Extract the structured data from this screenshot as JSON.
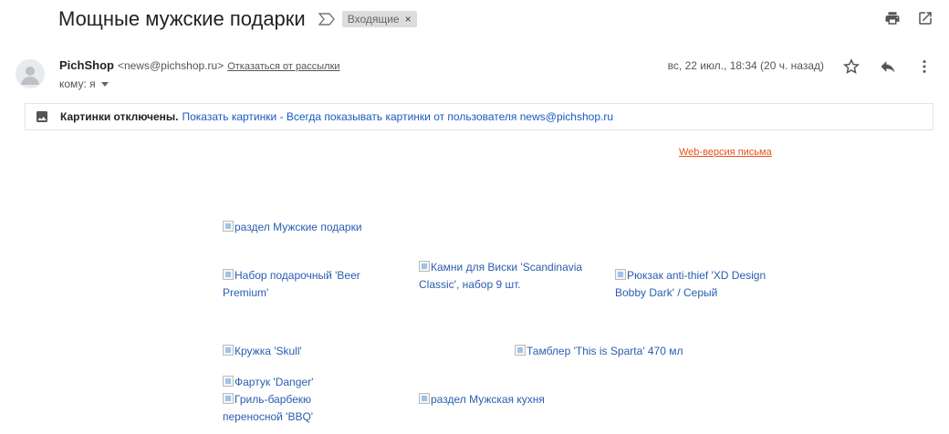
{
  "email": {
    "subject": "Мощные мужские подарки",
    "label": "Входящие",
    "label_close": "×",
    "sender": {
      "name": "PichShop",
      "email": "<news@pichshop.ru>",
      "unsubscribe": "Отказаться от рассылки"
    },
    "to_line": "кому: я",
    "date": "вс, 22 июл., 18:34 (20 ч. назад)",
    "images_notice": {
      "bold": "Картинки отключены.",
      "show_link": "Показать картинки - Всегда показывать картинки от пользователя news@pichshop.ru"
    }
  },
  "body": {
    "web_version": "Web-версия письма",
    "products": {
      "section_men": "раздел Мужские подарки",
      "beer_set": "Набор подарочный 'Beer Premium'",
      "whisky_stones": "Камни для Виски 'Scandinavia Classic', набор 9 шт.",
      "backpack": "Рюкзак anti-thief 'XD Design Bobby Dark' / Серый",
      "mug": "Кружка 'Skull'",
      "tumbler": "Тамблер 'This is Sparta' 470 мл",
      "apron": "Фартук 'Danger'",
      "grill": "Гриль-барбекю переносной 'BBQ'",
      "section_kitchen": "раздел Мужская кухня"
    }
  },
  "icons": {
    "importance": "importance-marker-icon",
    "print": "print-icon",
    "open_new_window": "open-in-new-window-icon",
    "avatar": "avatar-person-icon",
    "star": "star-icon",
    "reply": "reply-icon",
    "more": "more-vert-icon",
    "image": "image-icon"
  },
  "colors": {
    "link": "#1a5bbf",
    "web_version": "#e8511a",
    "label_bg": "#dddddd"
  }
}
